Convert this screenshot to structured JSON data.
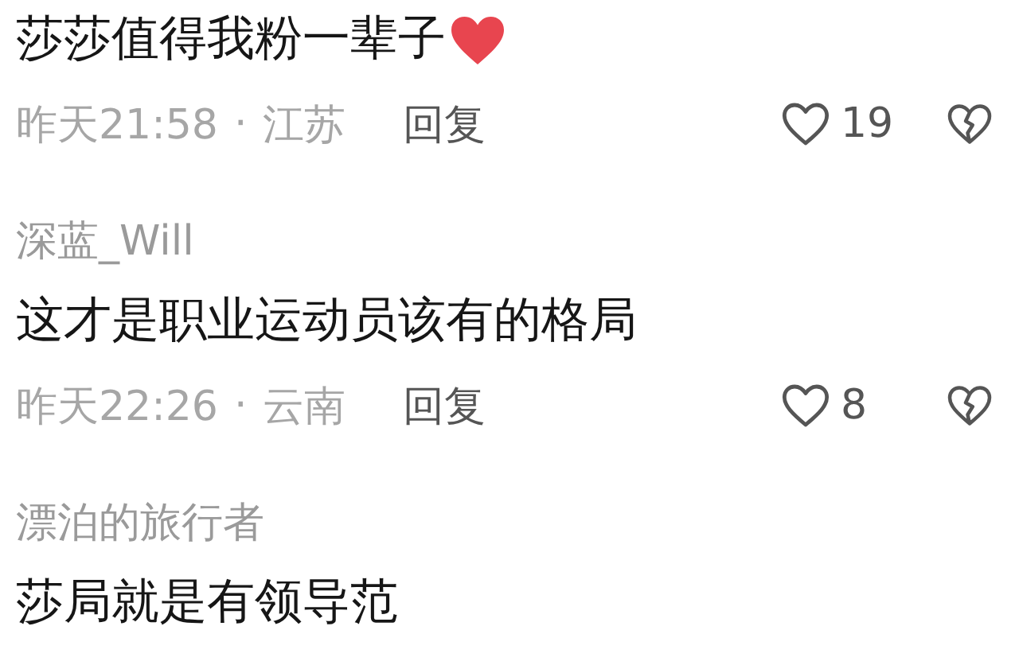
{
  "comments": [
    {
      "text": "莎莎值得我粉一辈子",
      "emoji_heart": true,
      "time": "昨天21:58",
      "separator": "·",
      "location": "江苏",
      "reply": "回复",
      "likes": "19"
    },
    {
      "username": "深蓝_Will",
      "text": "这才是职业运动员该有的格局",
      "emoji_heart": false,
      "time": "昨天22:26",
      "separator": "·",
      "location": "云南",
      "reply": "回复",
      "likes": "8"
    },
    {
      "username": "漂泊的旅行者",
      "text": "莎局就是有领导范",
      "emoji_heart": false
    }
  ]
}
